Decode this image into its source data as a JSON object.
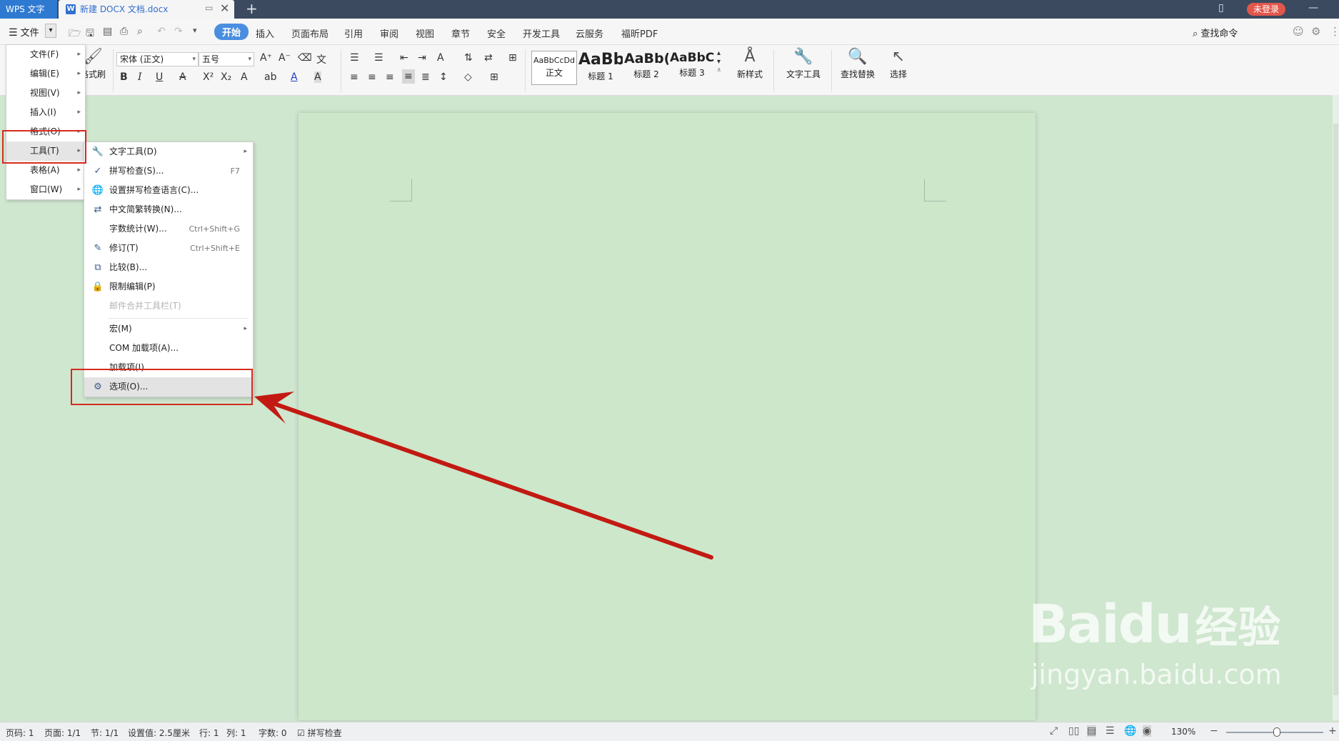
{
  "titlebar": {
    "app_tab": "WPS 文字",
    "doc_tab": "新建 DOCX 文档.docx",
    "login_label": "未登录"
  },
  "menubar": {
    "file_label": "文件",
    "tabs": [
      "开始",
      "插入",
      "页面布局",
      "引用",
      "审阅",
      "视图",
      "章节",
      "安全",
      "开发工具",
      "云服务",
      "福昕PDF"
    ],
    "active_tab": "开始",
    "find_command": "查找命令"
  },
  "ribbon": {
    "format_painter": "格式刷",
    "font_name": "宋体 (正文)",
    "font_size": "五号",
    "styles": [
      {
        "sample": "AaBbCcDd",
        "label": "正文"
      },
      {
        "sample": "AaBb",
        "label": "标题 1"
      },
      {
        "sample": "AaBb(",
        "label": "标题 2"
      },
      {
        "sample": "AaBbC(",
        "label": "标题 3"
      }
    ],
    "new_style": "新样式",
    "text_tools": "文字工具",
    "find_replace": "查找替换",
    "select": "选择"
  },
  "main_menu": {
    "items": [
      {
        "label": "文件(F)"
      },
      {
        "label": "编辑(E)"
      },
      {
        "label": "视图(V)"
      },
      {
        "label": "插入(I)"
      },
      {
        "label": "格式(O)"
      },
      {
        "label": "工具(T)"
      },
      {
        "label": "表格(A)"
      },
      {
        "label": "窗口(W)"
      }
    ],
    "highlighted": "工具(T)"
  },
  "tools_menu": {
    "items": [
      {
        "label": "文字工具(D)",
        "shortcut": "",
        "icon": "wrench-icon",
        "submenu": true
      },
      {
        "label": "拼写检查(S)...",
        "shortcut": "F7",
        "icon": "spellcheck-icon"
      },
      {
        "label": "设置拼写检查语言(C)...",
        "shortcut": "",
        "icon": "globe-icon"
      },
      {
        "label": "中文简繁转换(N)...",
        "shortcut": "",
        "icon": "convert-icon"
      },
      {
        "label": "字数统计(W)...",
        "shortcut": "Ctrl+Shift+G",
        "icon": ""
      },
      {
        "label": "修订(T)",
        "shortcut": "Ctrl+Shift+E",
        "icon": "track-changes-icon"
      },
      {
        "label": "比较(B)...",
        "shortcut": "",
        "icon": "compare-icon"
      },
      {
        "label": "限制编辑(P)",
        "shortcut": "",
        "icon": "lock-icon"
      },
      {
        "label": "邮件合并工具栏(T)",
        "shortcut": "",
        "icon": "",
        "disabled": true
      },
      {
        "label": "宏(M)",
        "shortcut": "",
        "icon": "",
        "submenu": true
      },
      {
        "label": "COM 加载项(A)...",
        "shortcut": "",
        "icon": ""
      },
      {
        "label": "加载项(I)...",
        "shortcut": "",
        "icon": ""
      },
      {
        "label": "选项(O)...",
        "shortcut": "",
        "icon": "gear-icon"
      }
    ],
    "highlighted": "选项(O)..."
  },
  "statusbar": {
    "page_code": "页码: 1",
    "page": "页面: 1/1",
    "section": "节: 1/1",
    "setting": "设置值: 2.5厘米",
    "row": "行: 1",
    "col": "列: 1",
    "word_count": "字数: 0",
    "spell_check": "拼写检查",
    "zoom": "130%"
  },
  "watermark": {
    "logo": "Bai",
    "logo_tail": "du",
    "cn": "经验",
    "url": "jingyan.baidu.com"
  },
  "colors": {
    "page_bg": "#cde7cb",
    "annotation_red": "#d62b1f",
    "titlebar": "#3b4a5e",
    "active_tab": "#4a8ee0"
  }
}
